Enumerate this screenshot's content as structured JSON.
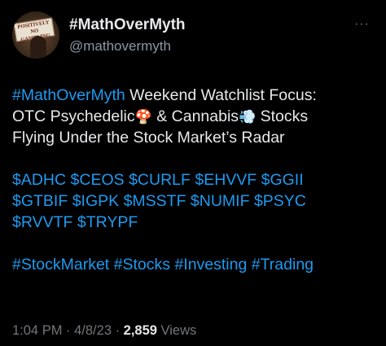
{
  "author": {
    "display_name": "#MathOverMyth",
    "handle": "@mathovermyth",
    "avatar_sign_text": "POSITIVELY NO GAMBLING"
  },
  "tweet": {
    "line1_hashtag": "#MathOverMyth",
    "line1_text": " Weekend Watchlist Focus:",
    "line2_a": "OTC Psychedelic",
    "line2_emoji1": "🍄",
    "line2_b": " & Cannabis",
    "line2_emoji2": "💨",
    "line2_c": " Stocks",
    "line3": "Flying Under the Stock Market’s Radar",
    "cashtags_row1": [
      "$ADHC",
      "$CEOS",
      "$CURLF",
      "$EHVVF",
      "$GGII"
    ],
    "cashtags_row2": [
      "$GTBIF",
      "$IGPK",
      "$MSSTF",
      "$NUMIF",
      "$PSYC"
    ],
    "cashtags_row3": [
      "$RVVTF",
      "$TRYPF"
    ],
    "hashtags": [
      "#StockMarket",
      "#Stocks",
      "#Investing",
      "#Trading"
    ]
  },
  "meta": {
    "time": "1:04 PM",
    "separator": " · ",
    "date": "4/8/23",
    "views_count": "2,859",
    "views_label": " Views"
  },
  "icons": {
    "more": "more-horizontal-icon"
  },
  "colors": {
    "background": "#000000",
    "link": "#1d9bf0",
    "text": "#e7e9ea",
    "muted": "#71767b"
  }
}
